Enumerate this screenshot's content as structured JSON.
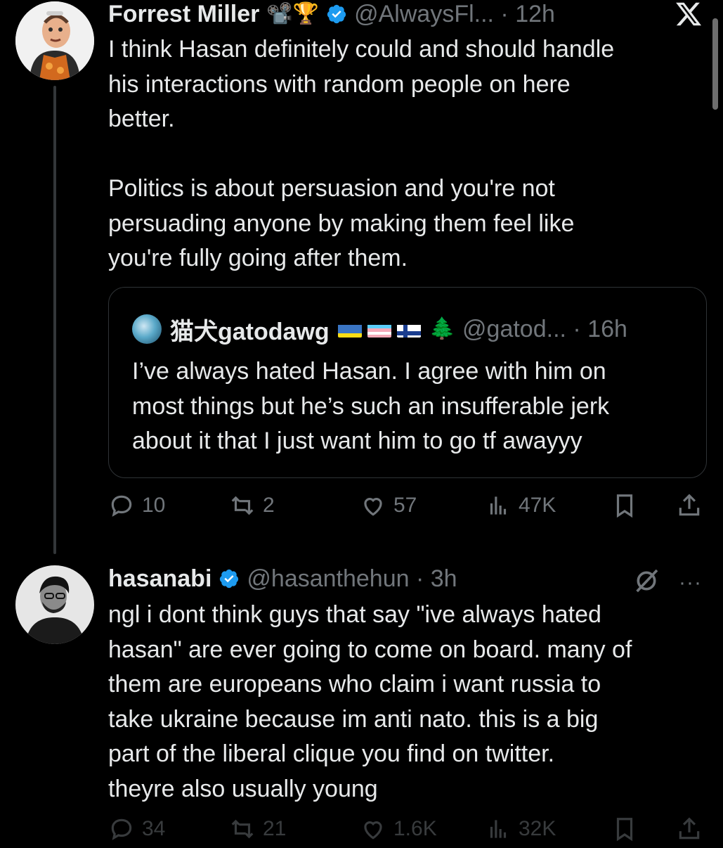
{
  "tweet1": {
    "name": "Forrest Miller",
    "emojis": "📽️🏆",
    "handle_meta": "@AlwaysFl... · 12h",
    "text": "I think Hasan definitely could and should handle\nhis interactions with random people on here\nbetter.\n\nPolitics is about persuasion and you're not\npersuading anyone by making them feel like\nyou're fully going after them.",
    "quote": {
      "name": "猫犬gatodawg",
      "handle_meta": "@gatod... · 16h",
      "text": "I’ve always hated Hasan. I agree with him on\nmost things but he’s such an insufferable jerk\nabout it that I just want him to go tf awayyy"
    },
    "actions": {
      "replies": "10",
      "reposts": "2",
      "likes": "57",
      "views": "47K"
    }
  },
  "tweet2": {
    "name": "hasanabi",
    "handle_meta": "@hasanthehun · 3h",
    "text": "ngl i dont think guys that say \"ive always hated\nhasan\" are ever going to come on board. many of\nthem are europeans who claim i want russia to\ntake ukraine because im anti nato. this is a big\npart of the liberal clique you find on twitter.\ntheyre also usually young",
    "more": "···",
    "actions": {
      "replies": "34",
      "reposts": "21",
      "likes": "1.6K",
      "views": "32K"
    }
  },
  "colors": {
    "background": "#000000",
    "text": "#e7e9ea",
    "muted": "#71767b",
    "verified": "#1d9bf0",
    "border": "#2f3336"
  }
}
